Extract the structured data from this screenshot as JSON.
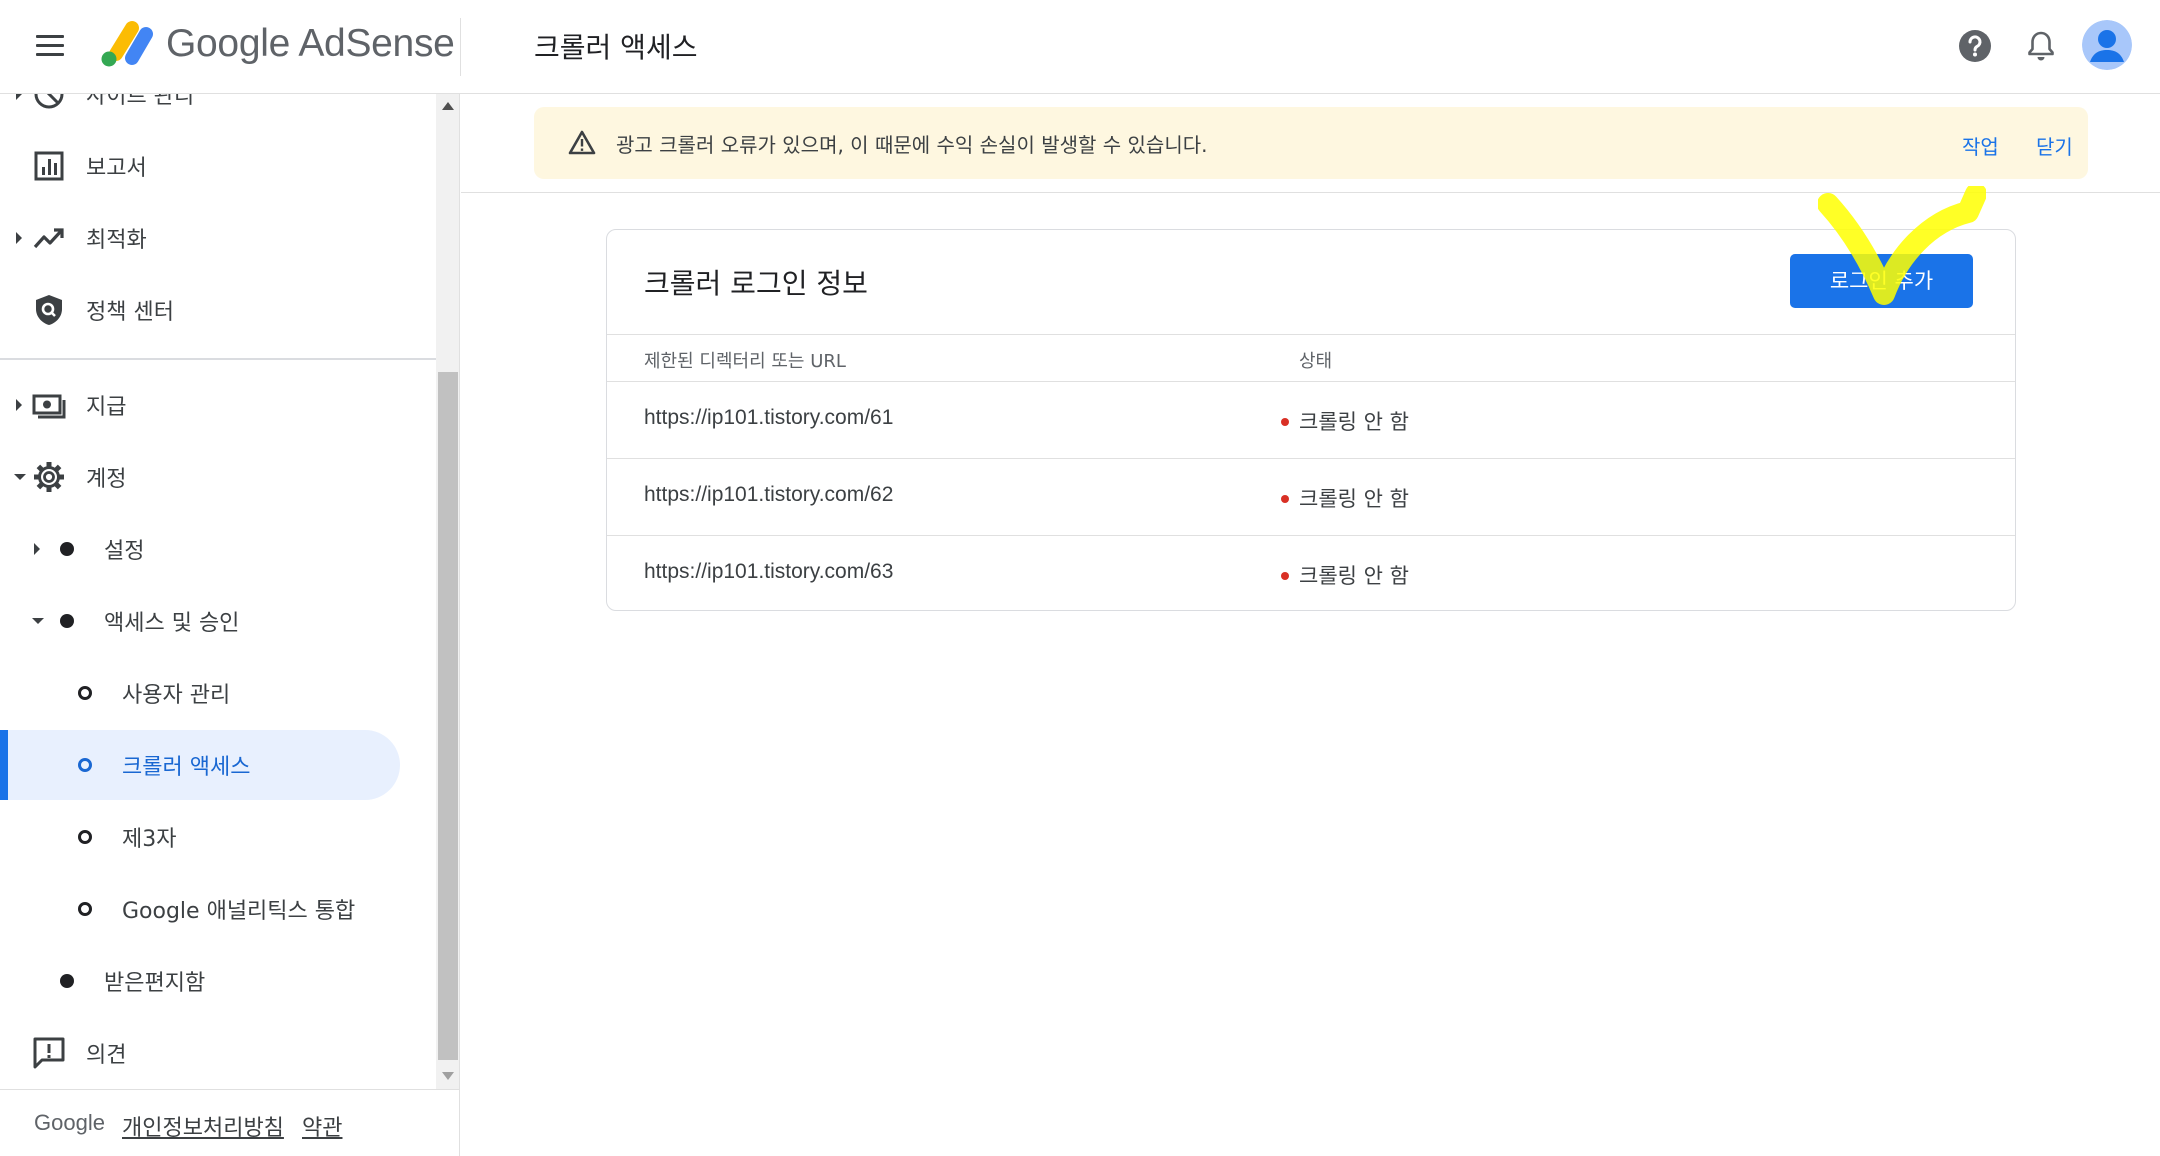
{
  "header": {
    "brand": "Google AdSense",
    "title": "크롤러 액세스"
  },
  "sidebar": {
    "items": {
      "site_management": "사이트 관리",
      "reports": "보고서",
      "optimization": "최적화",
      "policy_center": "정책 센터",
      "payments": "지급",
      "account": "계정",
      "settings": "설정",
      "access_authorization": "액세스 및 승인",
      "user_management": "사용자 관리",
      "crawler_access": "크롤러 액세스",
      "third_party": "제3자",
      "google_analytics": "Google 애널리틱스 통합",
      "inbox": "받은편지함",
      "feedback": "의견"
    },
    "footer": {
      "google": "Google",
      "privacy": "개인정보처리방침",
      "terms": "약관"
    }
  },
  "banner": {
    "message": "광고 크롤러 오류가 있으며, 이 때문에 수익 손실이 발생할 수 있습니다.",
    "action": "작업",
    "dismiss": "닫기"
  },
  "card": {
    "title": "크롤러 로그인 정보",
    "add_button": "로그인 추가",
    "columns": {
      "restricted": "제한된 디렉터리 또는 URL",
      "status": "상태"
    },
    "rows": [
      {
        "url": "https://ip101.tistory.com/61",
        "status": "크롤링 안 함"
      },
      {
        "url": "https://ip101.tistory.com/62",
        "status": "크롤링 안 함"
      },
      {
        "url": "https://ip101.tistory.com/63",
        "status": "크롤링 안 함"
      }
    ]
  },
  "colors": {
    "accent": "#1a73e8",
    "active_nav_bg": "#e8f0fe",
    "banner_bg": "#fef7e0",
    "status_error": "#d93025",
    "annotation": "#ffff00"
  },
  "icons": {
    "menu": "hamburger-menu-icon",
    "help": "help-circle-icon",
    "notifications": "bell-icon",
    "account": "account-avatar",
    "warning": "warning-triangle-icon"
  }
}
